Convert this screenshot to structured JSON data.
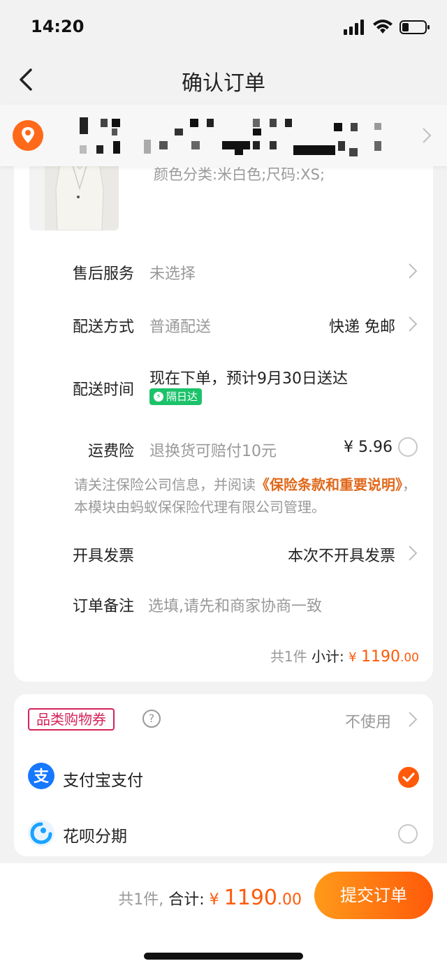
{
  "status_bar": {
    "time": "14:20"
  },
  "nav": {
    "title": "确认订单"
  },
  "product": {
    "sku": "颜色分类:米白色;尺码:XS;"
  },
  "after_sales": {
    "label": "售后服务",
    "value": "未选择"
  },
  "delivery_method": {
    "label": "配送方式",
    "value": "普通配送",
    "right": "快递 免邮"
  },
  "delivery_time": {
    "label": "配送时间",
    "value": "现在下单，预计9月30日送达",
    "badge": "隔日达"
  },
  "shipping_insurance": {
    "label": "运费险",
    "value": "退换货可赔付10元",
    "price": "¥ 5.96"
  },
  "notice": {
    "text_before": "请关注保险公司信息，并阅读",
    "link": "《保险条款和重要说明》",
    "text_after": "，本模块由蚂蚁保保险代理有限公司管理。"
  },
  "invoice": {
    "label": "开具发票",
    "value": "本次不开具发票"
  },
  "remark": {
    "label": "订单备注",
    "placeholder": "选填,请先和商家协商一致"
  },
  "subtotal": {
    "count": "共1件",
    "label": "小计:",
    "yen": "¥",
    "amount": "1190",
    "decimal": ".00"
  },
  "coupon": {
    "label": "品类购物券",
    "help": "?",
    "value": "不使用"
  },
  "payment": {
    "alipay": {
      "label": "支付宝支付",
      "selected": true
    },
    "huabei": {
      "label": "花呗分期",
      "selected": false
    }
  },
  "bottom": {
    "count": "共1件,",
    "label": "合计:",
    "yen": "¥",
    "amount": "1190",
    "decimal": ".00",
    "submit": "提交订单"
  },
  "colors": {
    "accent": "#ff5a0a",
    "green_badge": "#1cc26a",
    "coupon_red": "#d4245a",
    "alipay_blue": "#1677ff"
  }
}
